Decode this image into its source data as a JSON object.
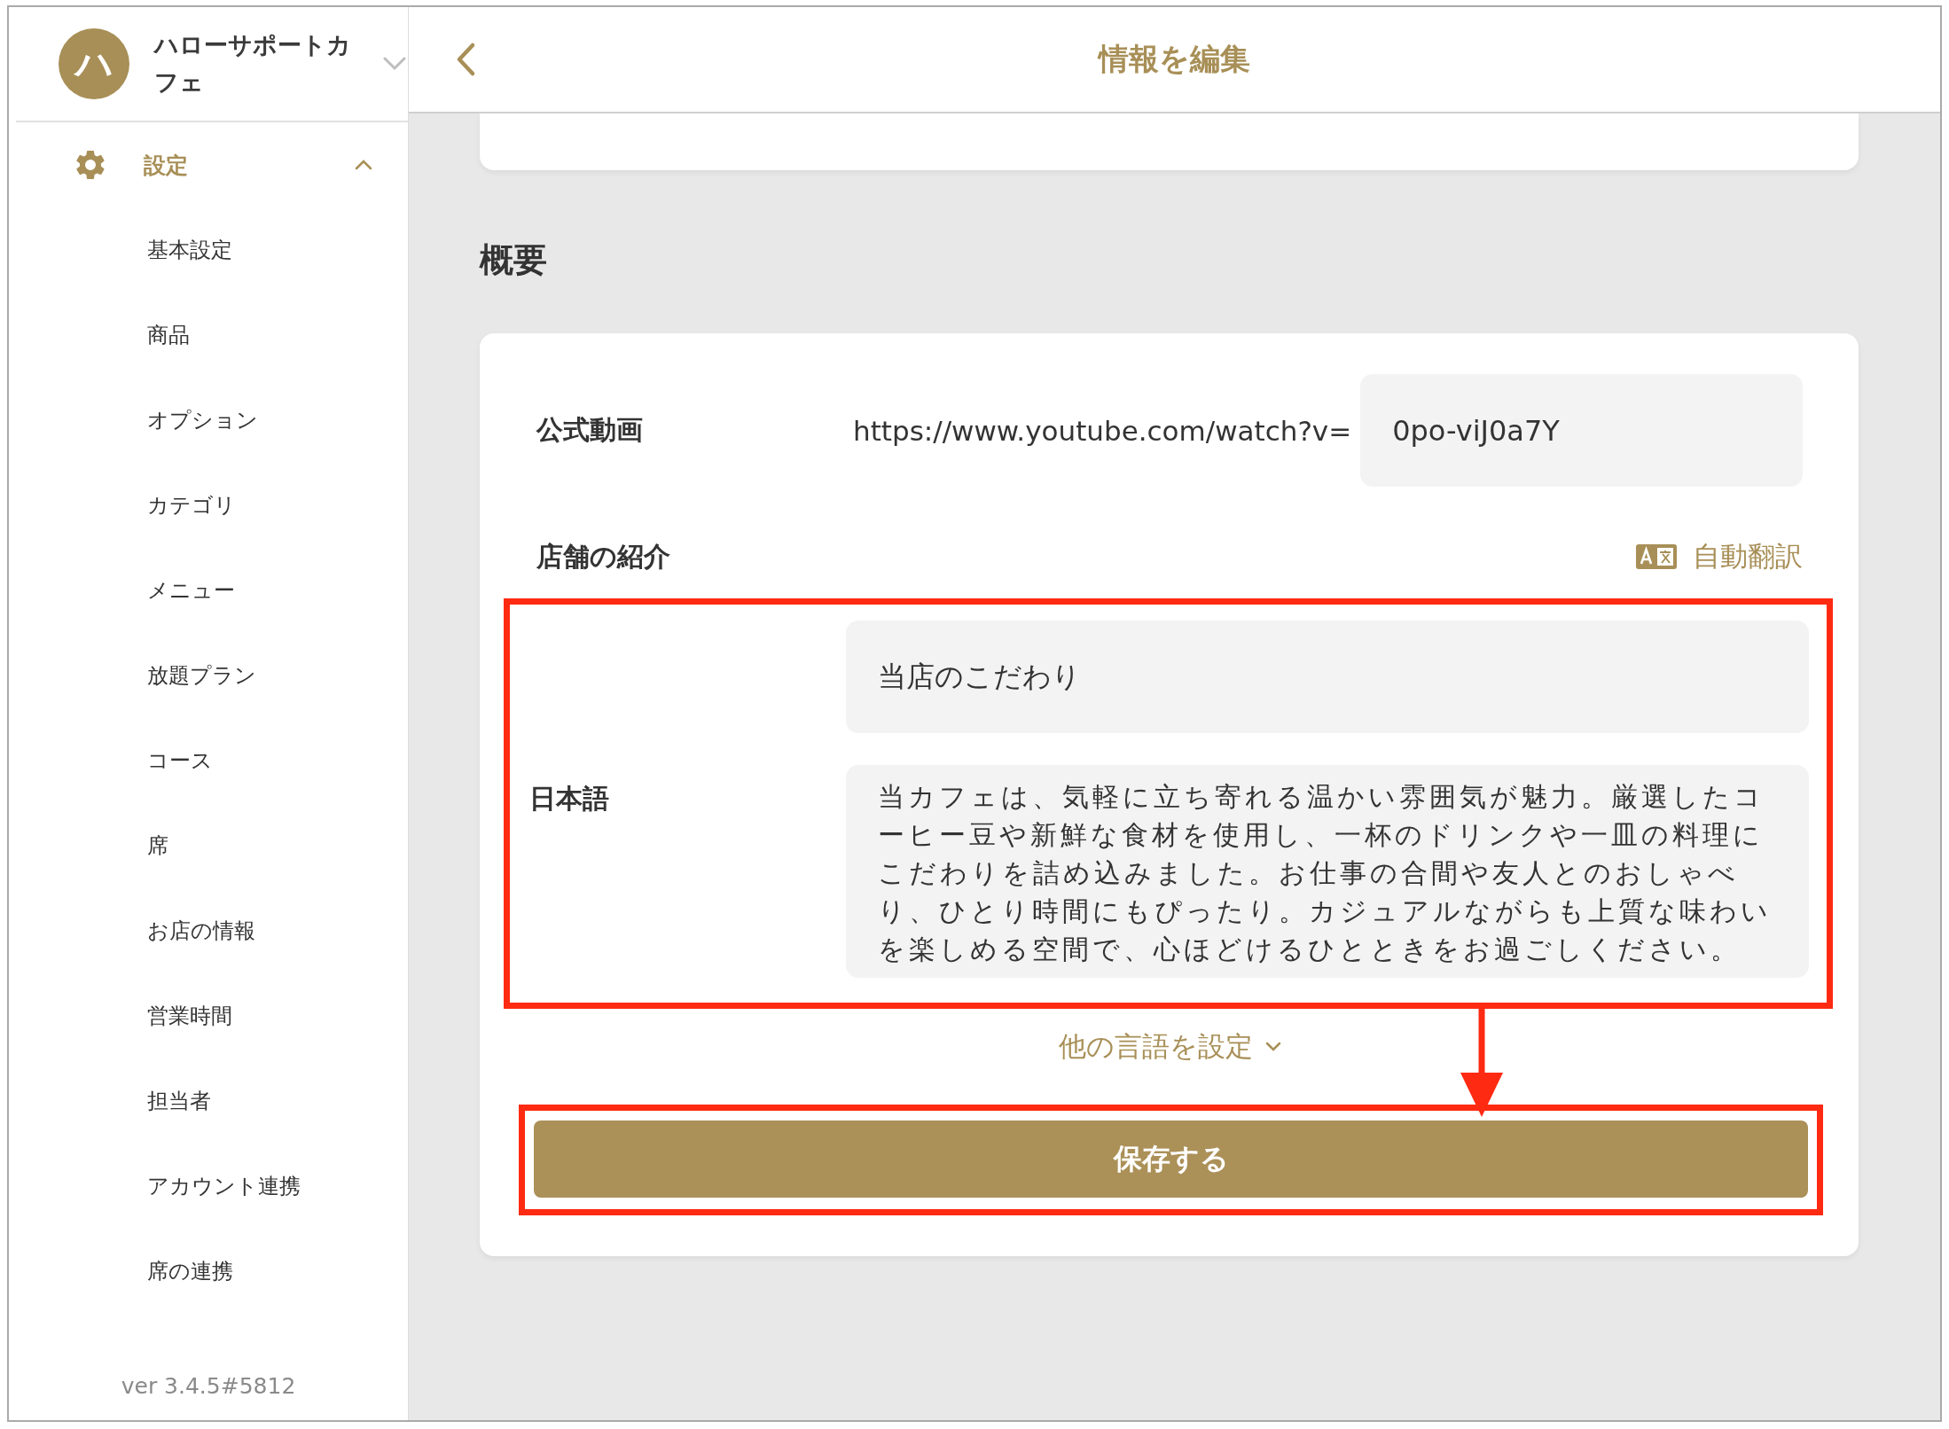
{
  "sidebar": {
    "shop": {
      "avatar": "ハ",
      "name": "ハローサポートカフェ"
    },
    "section": {
      "label": "設定",
      "expanded": true
    },
    "items": [
      "基本設定",
      "商品",
      "オプション",
      "カテゴリ",
      "メニュー",
      "放題プラン",
      "コース",
      "席",
      "お店の情報",
      "営業時間",
      "担当者",
      "アカウント連携",
      "席の連携"
    ],
    "version": "ver 3.4.5#5812"
  },
  "header": {
    "title": "情報を編集"
  },
  "overview": {
    "heading": "概要",
    "video": {
      "label": "公式動画",
      "prefix": "https://www.youtube.com/watch?v=",
      "value": "0po-viJ0a7Y"
    },
    "intro": {
      "label": "店舗の紹介",
      "translate": "自動翻訳",
      "language": "日本語",
      "title_value": "当店のこだわり",
      "body_value": "当カフェは、気軽に立ち寄れる温かい雰囲気が魅力。厳選したコーヒー豆や新鮮な食材を使用し、一杯のドリンクや一皿の料理にこだわりを詰め込みました。お仕事の合間や友人とのおしゃべり、ひとり時間にもぴったり。カジュアルながらも上質な味わいを楽しめる空間で、心ほどけるひとときをお過ごしください。"
    },
    "more_languages": "他の言語を設定",
    "save": "保存する"
  }
}
